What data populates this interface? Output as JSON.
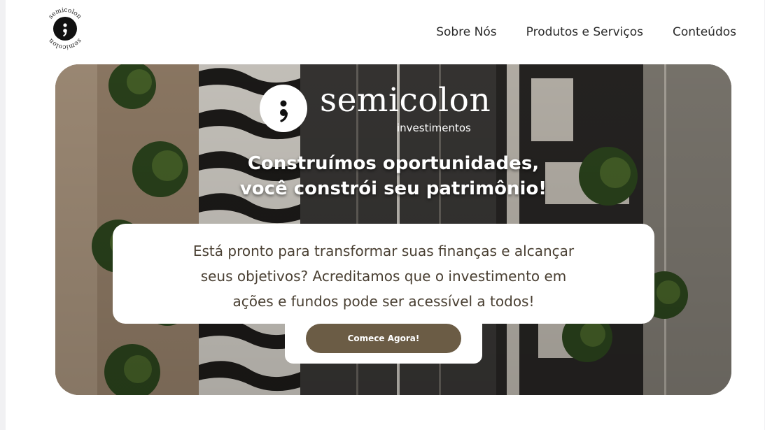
{
  "header": {
    "logo_text": "semicolon",
    "nav": [
      "Sobre Nós",
      "Produtos e Serviços",
      "Conteúdos"
    ]
  },
  "hero": {
    "brand_name": "semicolon",
    "brand_sub": "investimentos",
    "headline_line1": "Construímos oportunidades,",
    "headline_line2": "você constrói seu patrimônio!",
    "body_line1": "Está pronto para transformar suas finanças e alcançar",
    "body_line2": "seus objetivos? Acreditamos que o investimento em",
    "body_line3": "ações e fundos pode ser acessível a todos!",
    "cta_label": "Comece Agora!"
  },
  "colors": {
    "accent": "#6b5c45",
    "body_text": "#4a4033"
  }
}
